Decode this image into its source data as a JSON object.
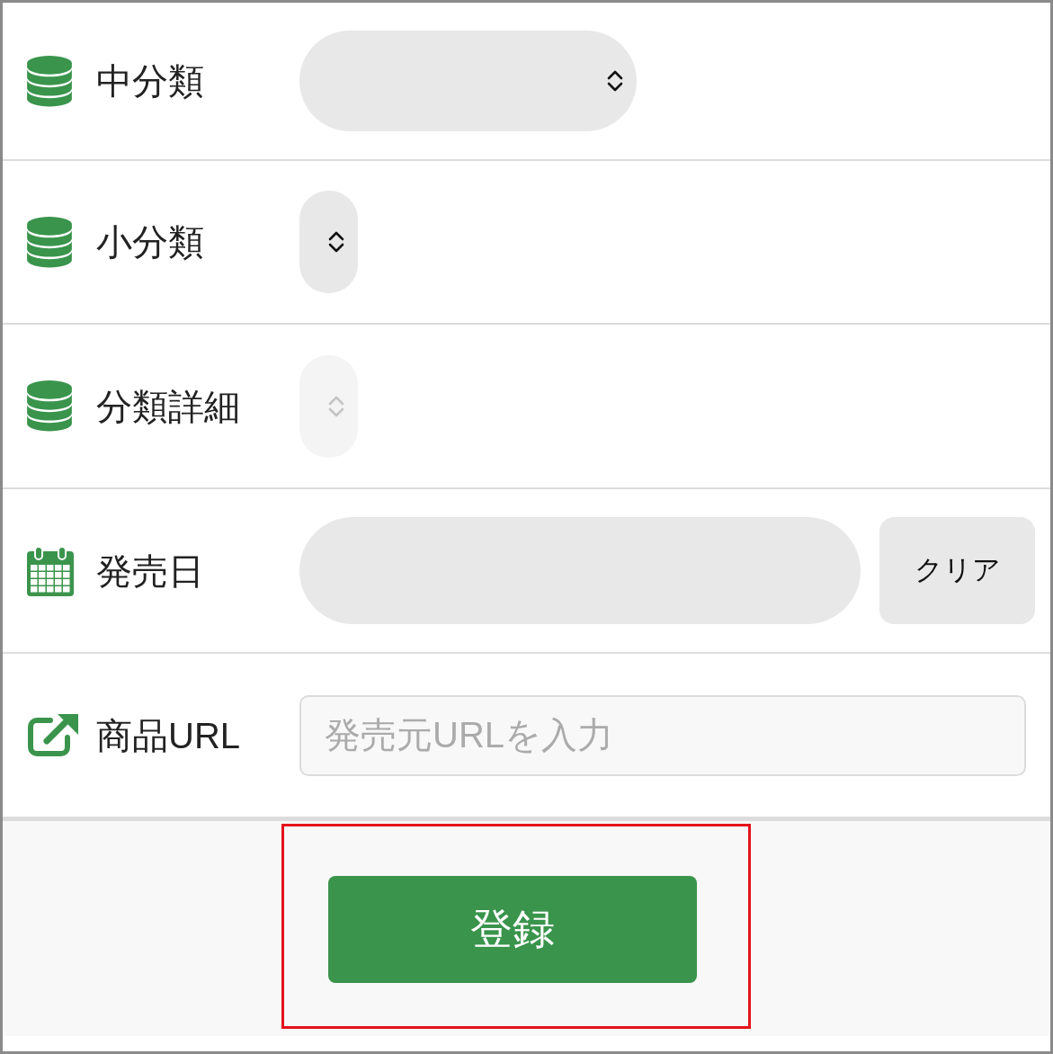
{
  "form": {
    "rows": [
      {
        "kind": "select",
        "label": "中分類",
        "disabled": false
      },
      {
        "kind": "select",
        "label": "小分類",
        "disabled": false
      },
      {
        "kind": "select",
        "label": "分類詳細",
        "disabled": true
      },
      {
        "kind": "date",
        "label": "発売日",
        "disabled": false,
        "clear_button": "クリア"
      },
      {
        "kind": "url",
        "label": "商品URL",
        "disabled": false,
        "placeholder": "発売元URLを入力"
      }
    ]
  },
  "submit": {
    "label": "登録",
    "highlighted": true
  }
}
